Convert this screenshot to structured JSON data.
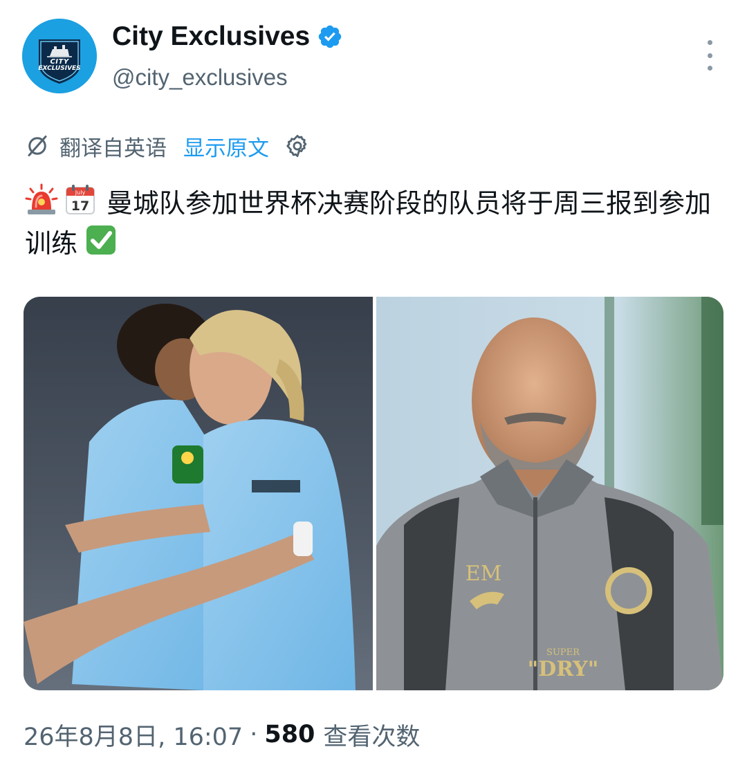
{
  "tweet": {
    "author": {
      "display_name": "City Exclusives",
      "handle": "@city_exclusives",
      "verified": true,
      "avatar_text_line1": "CITY",
      "avatar_text_line2": "EXCLUSIVES",
      "avatar_color": "#1ba0e2"
    },
    "translation": {
      "label": "翻译自英语",
      "show_original": "显示原文"
    },
    "text_main": "曼城队参加世界杯决赛阶段的队员将于周三报到参加训练",
    "emoji": [
      "rotating-light",
      "calendar",
      "check-mark"
    ],
    "calendar_emoji": {
      "month": "July",
      "day": "17"
    },
    "media": [
      {
        "name": "players-celebrating-photo",
        "jersey_patch": "Carabao Cup"
      },
      {
        "name": "coach-portrait-photo",
        "shirt_initials": "EM",
        "shirt_brand_top": "SUPER",
        "shirt_brand": "\"DRY\""
      }
    ],
    "meta": {
      "timestamp": "26年8月8日, 16:07",
      "separator": "·",
      "views_count": "580",
      "views_label": "查看次数"
    }
  },
  "colors": {
    "accent": "#1d9bf0",
    "text_primary": "#0f1419",
    "text_secondary": "#536471"
  }
}
